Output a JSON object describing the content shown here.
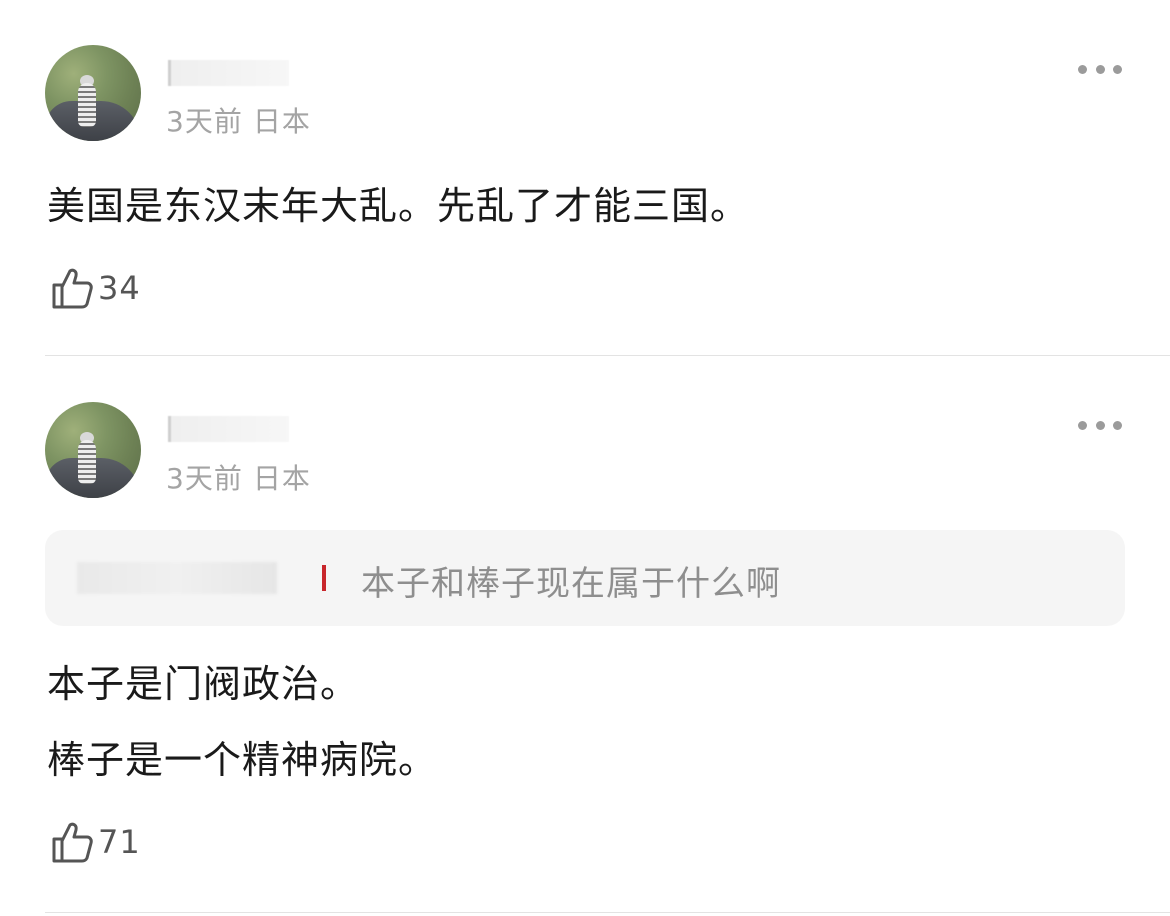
{
  "comments": [
    {
      "time": "3天前",
      "location": "日本",
      "lines": [
        "美国是东汉末年大乱。先乱了才能三国。"
      ],
      "likes": "34"
    },
    {
      "time": "3天前",
      "location": "日本",
      "quote": "本子和棒子现在属于什么啊",
      "lines": [
        "本子是门阀政治。",
        "棒子是一个精神病院。"
      ],
      "likes": "71"
    }
  ],
  "icons": {
    "like": "thumbs-up-outline-icon",
    "more": "more-horizontal-icon",
    "avatar": "avatar-image"
  },
  "colors": {
    "meta_text": "#a4a4a4",
    "quote_bg": "#f5f5f5",
    "quote_accent": "#c8262b",
    "divider": "#e3e3e3"
  }
}
